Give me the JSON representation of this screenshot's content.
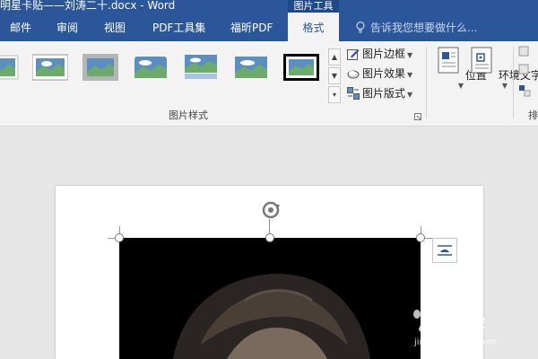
{
  "titlebar": {
    "title": "明星卡贴——刘涛二十.docx - Word",
    "context_tab": "图片工具"
  },
  "tabs": [
    {
      "label": "邮件"
    },
    {
      "label": "审阅"
    },
    {
      "label": "视图"
    },
    {
      "label": "PDF工具集"
    },
    {
      "label": "福昕PDF"
    },
    {
      "label": "格式"
    }
  ],
  "tell_me": "告诉我您想要做什么...",
  "ribbon": {
    "picture_styles_label": "图片样式",
    "commands": {
      "border": "图片边框",
      "effects": "图片效果",
      "layout": "图片版式"
    },
    "position": "位置",
    "wrap_text": "环境文字",
    "arrange_partial": "排"
  },
  "watermark": {
    "brand": "经验",
    "url": "jingyan.baidu.com"
  },
  "colors": {
    "ribbon_blue": "#2b579a",
    "ribbon_bg": "#f3f3f3"
  }
}
